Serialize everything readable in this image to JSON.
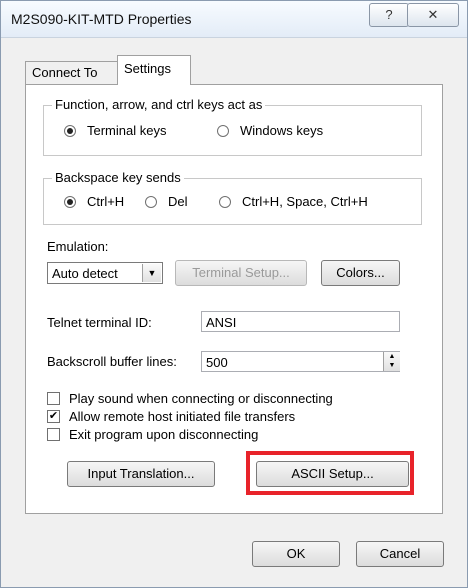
{
  "window": {
    "title": "M2S090-KIT-MTD Properties",
    "help_label": "?",
    "close_label": "✕"
  },
  "tabs": [
    {
      "label": "Connect To"
    },
    {
      "label": "Settings"
    }
  ],
  "settings": {
    "function_keys": {
      "legend": "Function, arrow, and ctrl keys act as",
      "options": [
        {
          "label": "Terminal keys",
          "selected": true
        },
        {
          "label": "Windows keys",
          "selected": false
        }
      ]
    },
    "backspace": {
      "legend": "Backspace key sends",
      "options": [
        {
          "label": "Ctrl+H",
          "selected": true
        },
        {
          "label": "Del",
          "selected": false
        },
        {
          "label": "Ctrl+H, Space, Ctrl+H",
          "selected": false
        }
      ]
    },
    "emulation": {
      "label": "Emulation:",
      "value": "Auto detect",
      "terminal_setup_label": "Terminal Setup...",
      "colors_label": "Colors..."
    },
    "telnet": {
      "label": "Telnet terminal ID:",
      "value": "ANSI"
    },
    "backscroll": {
      "label": "Backscroll buffer lines:",
      "value": "500"
    },
    "checkboxes": [
      {
        "label": "Play sound when connecting or disconnecting",
        "checked": false
      },
      {
        "label": "Allow remote host initiated file transfers",
        "checked": true
      },
      {
        "label": "Exit program upon disconnecting",
        "checked": false
      }
    ],
    "input_translation_label": "Input Translation...",
    "ascii_setup_label": "ASCII Setup...",
    "highlight_color": "#e8232a"
  },
  "footer": {
    "ok_label": "OK",
    "cancel_label": "Cancel"
  }
}
